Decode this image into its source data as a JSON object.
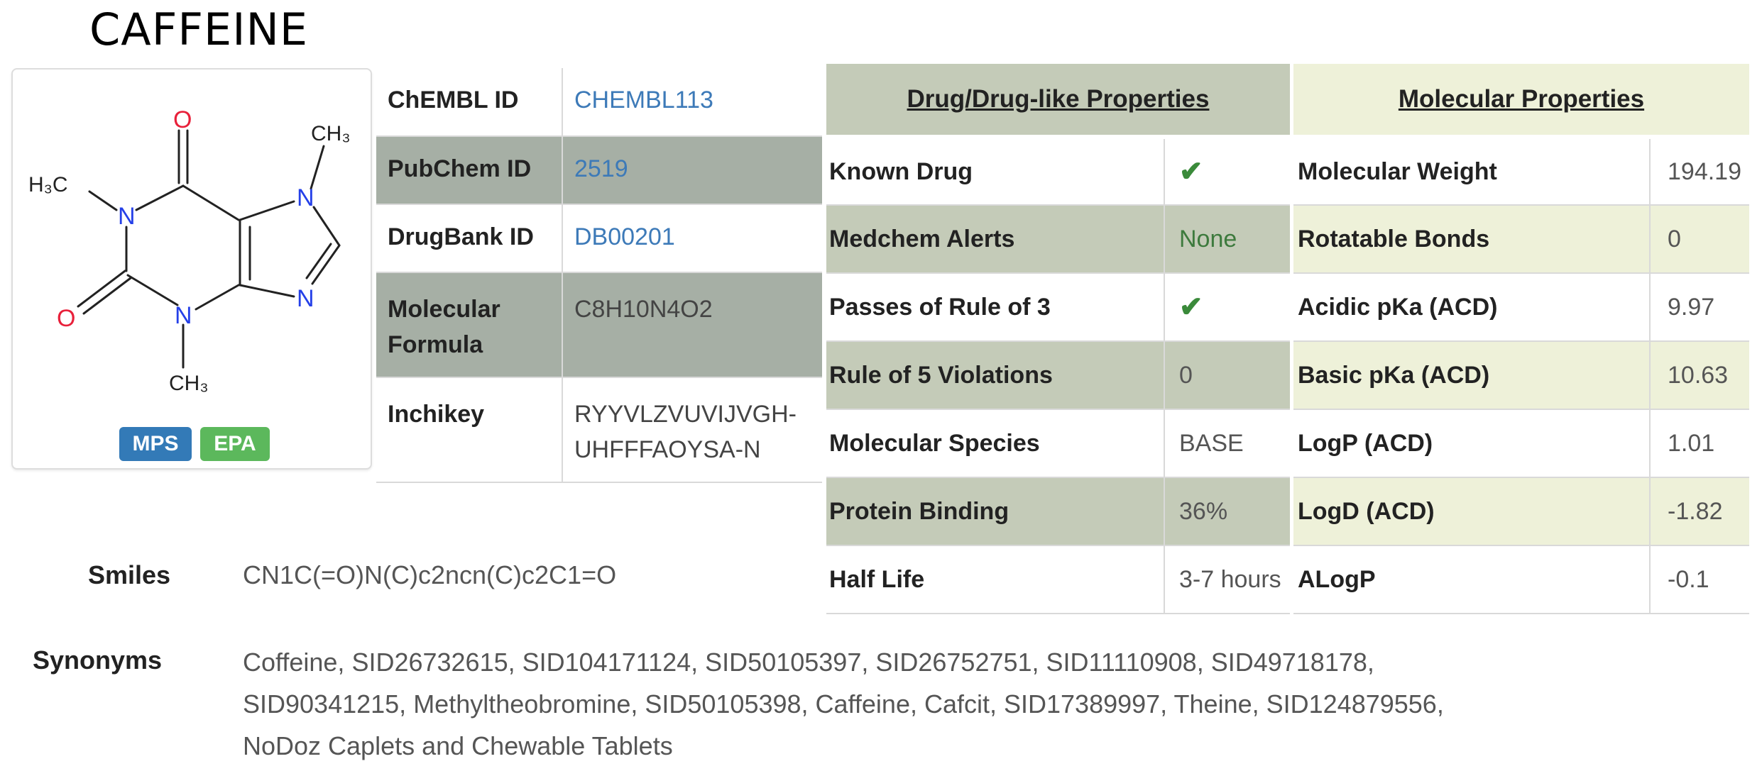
{
  "title": "CAFFEINE",
  "structure": {
    "atoms": {
      "o_top": "O",
      "o_left": "O",
      "n1": "N",
      "n3": "N",
      "n7": "N",
      "n9": "N",
      "ch3_left": "H₃C",
      "ch3_top": "CH₃",
      "ch3_bottom": "CH₃"
    },
    "badges": [
      "MPS",
      "EPA"
    ],
    "colors": {
      "oxygen": "#e8203a",
      "nitrogen": "#2540e8",
      "bond": "#222222",
      "mps": "#337ab7",
      "epa": "#5cb85c"
    }
  },
  "ids": [
    {
      "label": "ChEMBL ID",
      "value": "CHEMBL113"
    },
    {
      "label": "PubChem ID",
      "value": "2519"
    },
    {
      "label": "DrugBank ID",
      "value": "DB00201"
    },
    {
      "label": "Molecular Formula",
      "value": "C8H10N4O2"
    },
    {
      "label": "Inchikey",
      "value": "RYYVLZVUVIJVGH-UHFFFAOYSA-N"
    }
  ],
  "drug_props": {
    "header": "Drug/Drug-like Properties",
    "rows": [
      {
        "label": "Known Drug",
        "value": "✔"
      },
      {
        "label": "Medchem Alerts",
        "value": "None"
      },
      {
        "label": "Passes of Rule of 3",
        "value": "✔"
      },
      {
        "label": "Rule of 5 Violations",
        "value": "0"
      },
      {
        "label": "Molecular Species",
        "value": "BASE"
      },
      {
        "label": "Protein Binding",
        "value": "36%"
      },
      {
        "label": "Half Life",
        "value": "3-7 hours"
      }
    ]
  },
  "mol_props": {
    "header": "Molecular Properties",
    "rows": [
      {
        "label": "Molecular Weight",
        "value": "194.19"
      },
      {
        "label": "Rotatable Bonds",
        "value": "0"
      },
      {
        "label": "Acidic pKa (ACD)",
        "value": "9.97"
      },
      {
        "label": "Basic pKa (ACD)",
        "value": "10.63"
      },
      {
        "label": "LogP (ACD)",
        "value": "1.01"
      },
      {
        "label": "LogD (ACD)",
        "value": "-1.82"
      },
      {
        "label": "ALogP",
        "value": "-0.1"
      }
    ]
  },
  "smiles": {
    "label": "Smiles",
    "value": "CN1C(=O)N(C)c2ncn(C)c2C1=O"
  },
  "synonyms": {
    "label": "Synonyms",
    "value": "Coffeine, SID26732615, SID104171124, SID50105397, SID26752751, SID11110908, SID49718178, SID90341215, Methyltheobromine, SID50105398, Caffeine, Cafcit, SID17389997, Theine, SID124879556, NoDoz Caplets and Chewable Tablets"
  }
}
